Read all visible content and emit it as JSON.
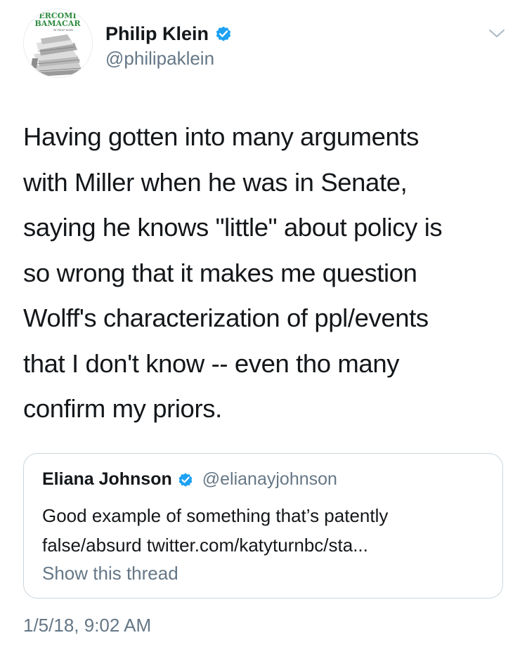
{
  "author": {
    "name": "Philip Klein",
    "handle": "@philipaklein",
    "verified": true,
    "avatar": {
      "icon": "book-cover-avatar",
      "cover_lines": [
        "ERCOMI",
        "BAMACAR",
        "BY PHILIP KLEIN"
      ]
    }
  },
  "menu": {
    "icon": "chevron-down-icon"
  },
  "tweet": {
    "lines": [
      "Having gotten into many arguments",
      "with Miller when he was in Senate,",
      "saying he knows \"little\" about policy is",
      "so wrong that it makes me question",
      "Wolff's characterization of ppl/events",
      "that I don't know -- even tho many",
      "confirm my priors."
    ]
  },
  "quote": {
    "name": "Eliana Johnson",
    "handle": "@elianayjohnson",
    "verified": true,
    "lines": [
      "Good example of something that’s patently",
      "false/absurd twitter.com/katyturnbc/sta..."
    ],
    "show_thread": "Show this thread"
  },
  "timestamp": "1/5/18, 9:02 AM",
  "colors": {
    "text": "#14171a",
    "secondary": "#657786",
    "verified_blue": "#1da1f2",
    "border": "#ccd6dd",
    "avatar_green": "#2e8b3e"
  }
}
